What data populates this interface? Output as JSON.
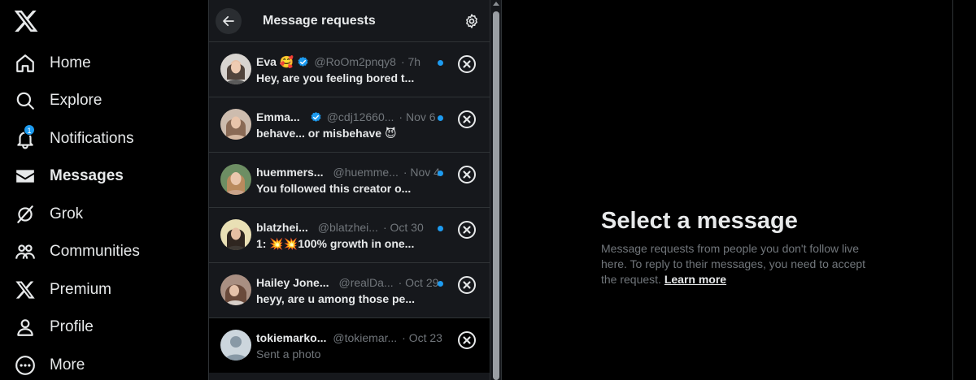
{
  "nav": {
    "items": [
      {
        "key": "home",
        "label": "Home",
        "icon": "home-icon"
      },
      {
        "key": "explore",
        "label": "Explore",
        "icon": "search-icon"
      },
      {
        "key": "notifications",
        "label": "Notifications",
        "icon": "bell-icon",
        "badge": "1"
      },
      {
        "key": "messages",
        "label": "Messages",
        "icon": "envelope-icon",
        "active": true
      },
      {
        "key": "grok",
        "label": "Grok",
        "icon": "grok-icon"
      },
      {
        "key": "communities",
        "label": "Communities",
        "icon": "communities-icon"
      },
      {
        "key": "premium",
        "label": "Premium",
        "icon": "x-logo-icon"
      },
      {
        "key": "profile",
        "label": "Profile",
        "icon": "person-icon"
      },
      {
        "key": "more",
        "label": "More",
        "icon": "more-circle-icon"
      }
    ]
  },
  "requests": {
    "title": "Message requests",
    "items": [
      {
        "name": "Eva",
        "emoji": "🥰",
        "verified": true,
        "handle": "@RoOm2pnqy8",
        "time": "· 7h",
        "preview": "Hey, are you feeling bored t...",
        "unread": true
      },
      {
        "name": "Emma...",
        "emoji": "",
        "verified": true,
        "handle": "@cdj12660...",
        "time": "· Nov 6",
        "preview": "behave... or misbehave 😈",
        "unread": true
      },
      {
        "name": "huemmers...",
        "emoji": "",
        "verified": false,
        "handle": "@huemme...",
        "time": "· Nov 4",
        "preview": "You followed this creator o...",
        "unread": true
      },
      {
        "name": "blatzhei...",
        "emoji": "",
        "verified": false,
        "handle": "@blatzhei...",
        "time": "· Oct 30",
        "preview": "1: 💥💥100% growth in one...",
        "unread": true
      },
      {
        "name": "Hailey Jone...",
        "emoji": "",
        "verified": false,
        "handle": "@realDa...",
        "time": "· Oct 29",
        "preview": "heyy, are u among those pe...",
        "unread": true
      },
      {
        "name": "tokiemarko...",
        "emoji": "",
        "verified": false,
        "handle": "@tokiemar...",
        "time": "· Oct 23",
        "preview": "Sent a photo",
        "unread": false
      }
    ]
  },
  "detail": {
    "title": "Select a message",
    "body": "Message requests from people you don't follow live here. To reply to their messages, you need to accept the request.",
    "link": "Learn more"
  },
  "colors": {
    "accent": "#1d9bf0",
    "text": "#e7e9ea",
    "muted": "#71767b",
    "panel": "#16181c",
    "border": "#2f3336"
  }
}
